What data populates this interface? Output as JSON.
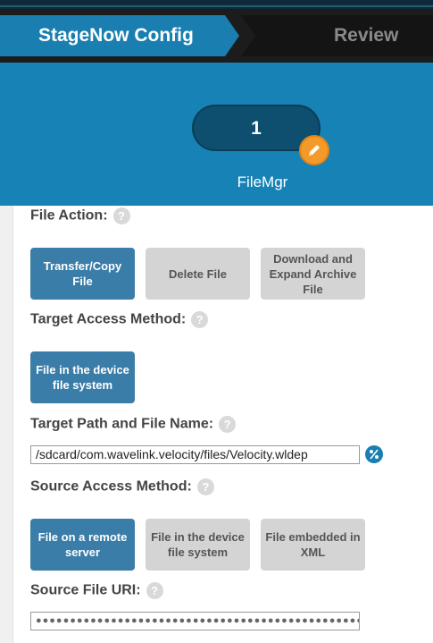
{
  "wizard": {
    "steps": [
      {
        "label": "StageNow Config",
        "active": true
      },
      {
        "label": "Review",
        "active": false
      }
    ]
  },
  "feature": {
    "count": "1",
    "name": "FileMgr",
    "edit_icon": "pencil-icon"
  },
  "form": {
    "file_action": {
      "label": "File Action:",
      "options": [
        "Transfer/Copy File",
        "Delete File",
        "Download and Expand Archive File"
      ],
      "selected": "Transfer/Copy File"
    },
    "target_access": {
      "label": "Target Access Method:",
      "options": [
        "File in the device file system"
      ],
      "selected": "File in the device file system"
    },
    "target_path": {
      "label": "Target Path and File Name:",
      "value": "/sdcard/com.wavelink.velocity/files/Velocity.wldep"
    },
    "source_access": {
      "label": "Source Access Method:",
      "options": [
        "File on a remote server",
        "File in the device file system",
        "File embedded in XML"
      ],
      "selected": "File on a remote server"
    },
    "source_uri": {
      "label": "Source File URI:",
      "value": "●●●●●●●●●●●●●●●●●●●●●●●●●●●●●●●●●●●●●●●●●●●●●●●●●●"
    },
    "help_glyph": "?"
  },
  "colors": {
    "primary": "#1682b5",
    "selected": "#3a7da8",
    "unselected": "#d4d4d4",
    "accent": "#f39a29"
  }
}
